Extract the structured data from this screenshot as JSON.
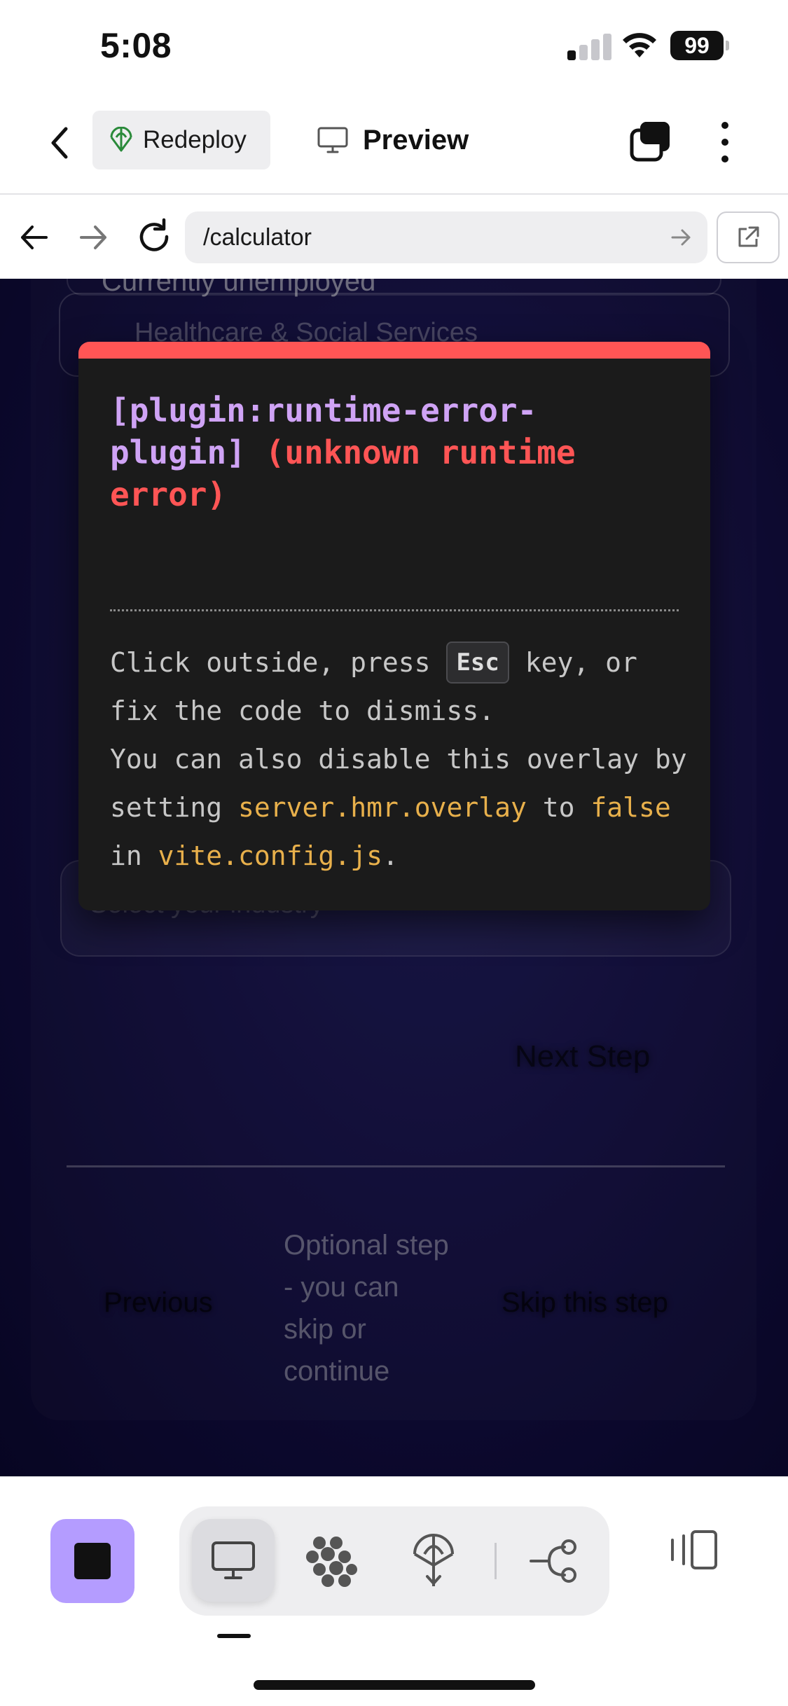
{
  "status_bar": {
    "time": "5:08",
    "battery": "99"
  },
  "header": {
    "redeploy_label": "Redeploy",
    "preview_label": "Preview"
  },
  "browser": {
    "url": "/calculator"
  },
  "form": {
    "option_unemployed": "Currently unemployed",
    "industry_option": "Healthcare & Social Services",
    "industry_placeholder": "Select your industry",
    "next_step": "Next Step",
    "previous": "Previous",
    "optional_note": "Optional step - you can skip or continue",
    "skip": "Skip this step"
  },
  "error_overlay": {
    "plugin": "[plugin:runtime-error-plugin]",
    "message": "(unknown runtime error)",
    "tip_1": "Click outside, press",
    "tip_key": "Esc",
    "tip_2": "key, or fix the code to dismiss.",
    "tip_3": "You can also disable this overlay by setting",
    "tip_code_1": "server.hmr.overlay",
    "tip_4": "to",
    "tip_code_2": "false",
    "tip_5": "in",
    "tip_code_3": "vite.config.js",
    "tip_6": ".",
    "accent_color": "#ff5555"
  },
  "toolbar": {
    "icons": [
      "stop-icon",
      "desktop-icon",
      "workflow-icon",
      "deploy-icon",
      "git-icon",
      "layout-toggle-icon"
    ],
    "accent_color": "#b49cff"
  }
}
